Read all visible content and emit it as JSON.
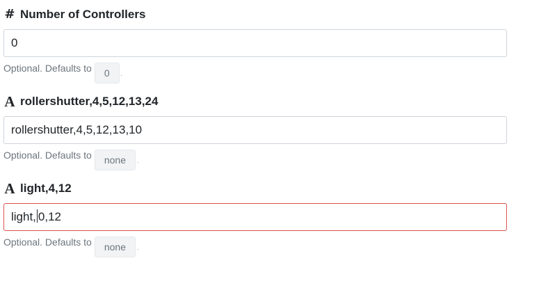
{
  "fields": [
    {
      "icon": "hash-icon",
      "icon_glyph": "#",
      "label": "Number of Controllers",
      "value": "0",
      "help_prefix": "Optional. Defaults to",
      "default": "0",
      "help_suffix": "."
    },
    {
      "icon": "text-type-icon",
      "icon_glyph": "A",
      "label": "rollershutter,4,5,12,13,24",
      "value": "rollershutter,4,5,12,13,10",
      "help_prefix": "Optional. Defaults to",
      "default": "none",
      "help_suffix": "."
    },
    {
      "icon": "text-type-icon",
      "icon_glyph": "A",
      "label": "light,4,12",
      "value_before_caret": "light,",
      "value_after_caret": "0,12",
      "help_prefix": "Optional. Defaults to",
      "default": "none",
      "help_suffix": ".",
      "state": "invalid",
      "border_color": "#d9534f"
    }
  ]
}
